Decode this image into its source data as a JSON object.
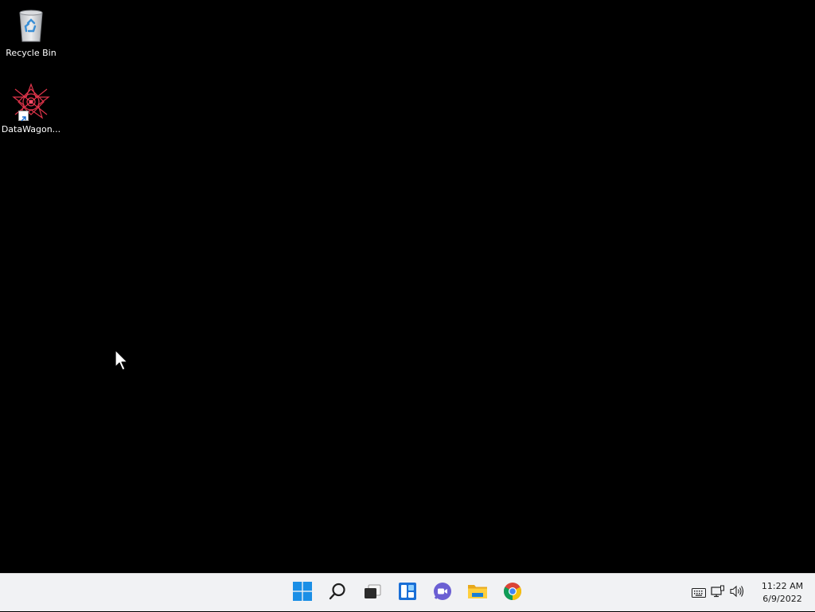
{
  "desktop": {
    "background_color": "#000000",
    "icons": [
      {
        "label": "Recycle Bin",
        "icon": "recycle-bin-icon"
      },
      {
        "label": "DataWagon...",
        "icon": "datawagon-icon"
      }
    ]
  },
  "taskbar": {
    "background_color": "#f1f2f4",
    "pinned": [
      {
        "name": "start",
        "icon": "windows-logo-icon"
      },
      {
        "name": "search",
        "icon": "search-icon"
      },
      {
        "name": "task-view",
        "icon": "task-view-icon"
      },
      {
        "name": "widgets",
        "icon": "widgets-icon"
      },
      {
        "name": "chat",
        "icon": "teams-chat-icon"
      },
      {
        "name": "file-explorer",
        "icon": "folder-icon"
      },
      {
        "name": "chrome",
        "icon": "chrome-icon"
      }
    ],
    "tray": {
      "icons": [
        "keyboard-icon",
        "network-icon",
        "volume-icon"
      ],
      "time": "11:22 AM",
      "date": "6/9/2022"
    }
  }
}
